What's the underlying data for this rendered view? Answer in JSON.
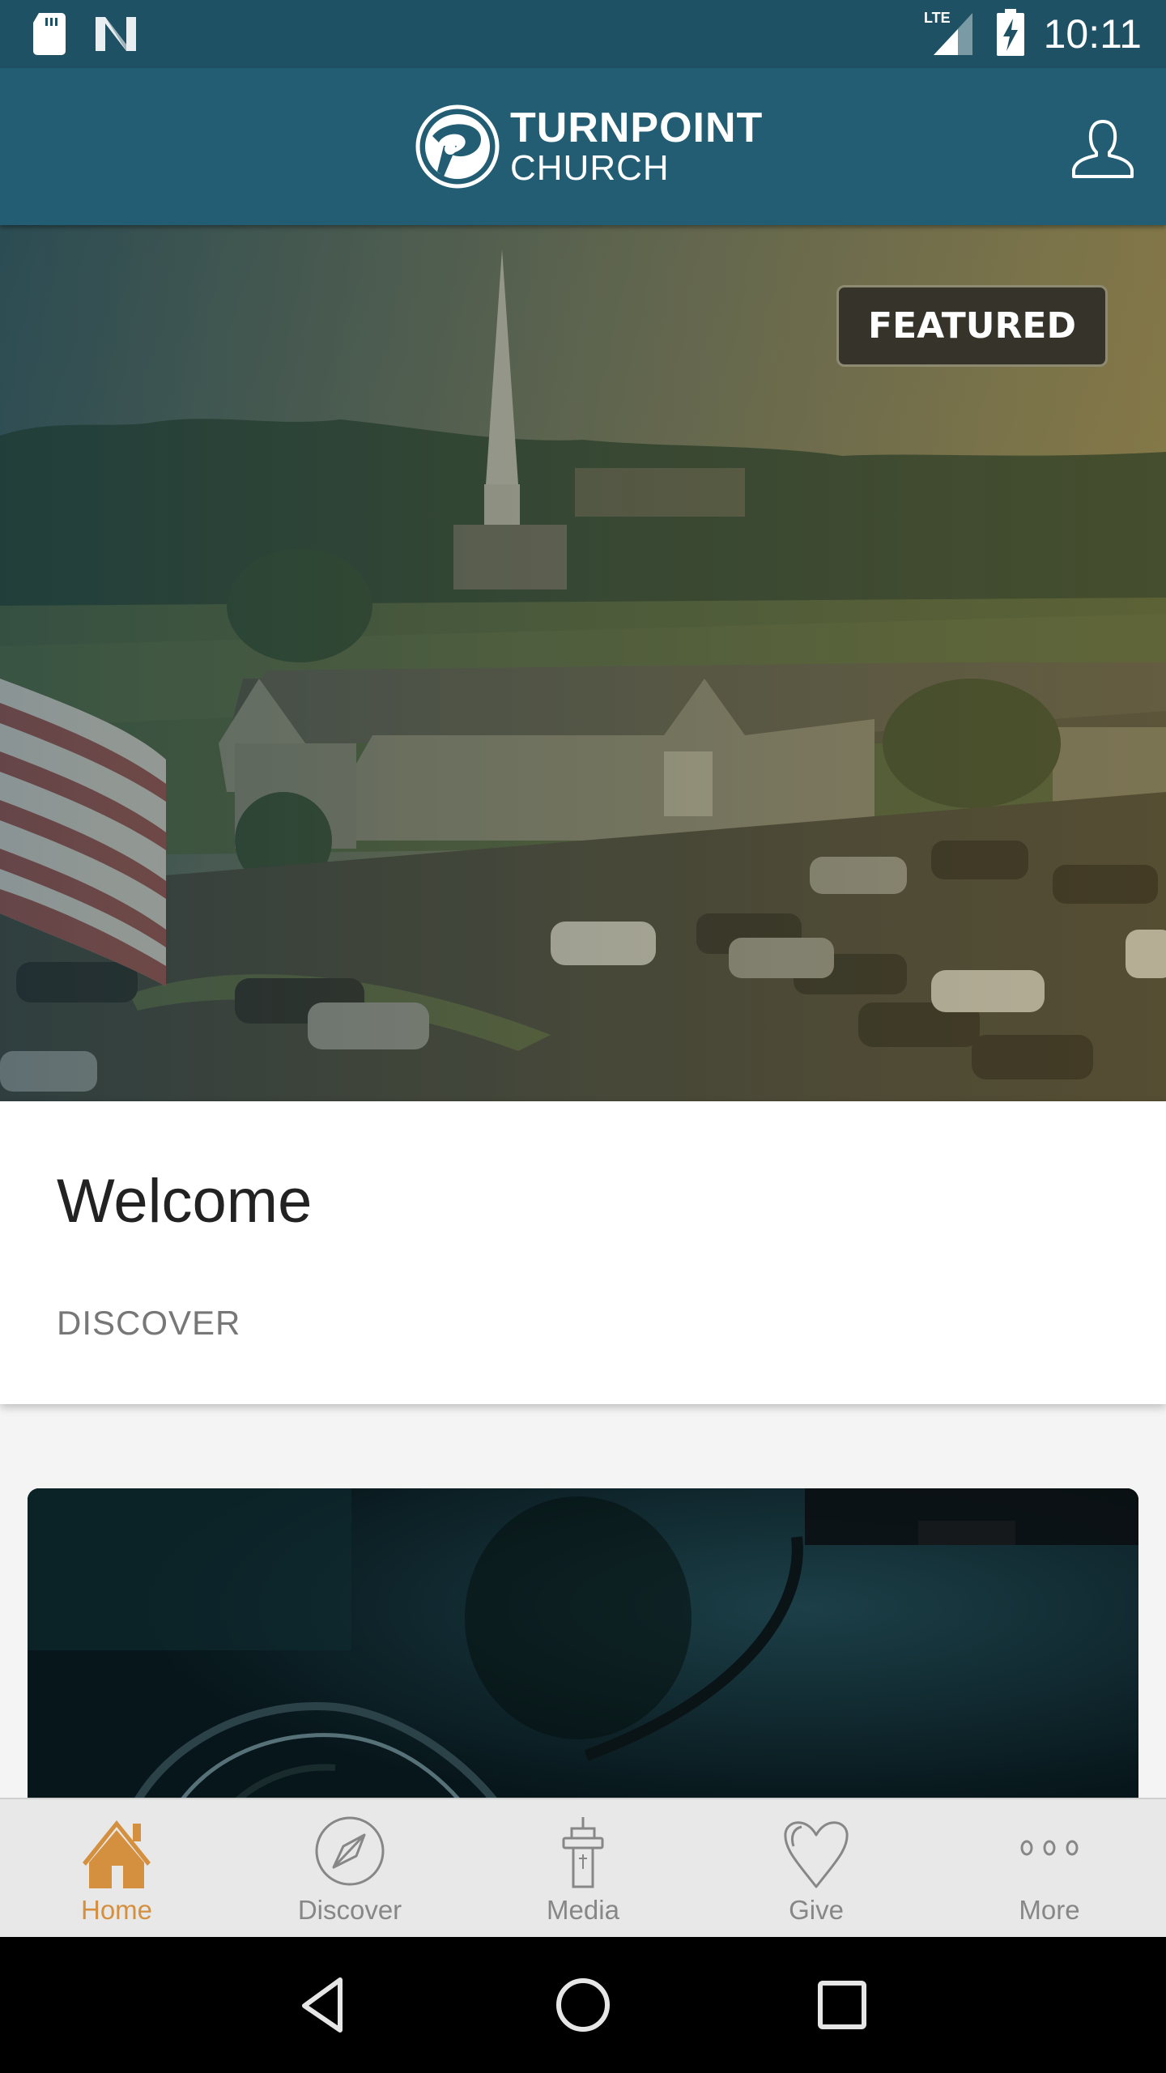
{
  "status_bar": {
    "time": "10:11",
    "network": "LTE",
    "icons": [
      "sd-card-icon",
      "n-notification-icon",
      "lte-signal-icon",
      "battery-charging-icon"
    ]
  },
  "app_bar": {
    "brand_line1": "TURNPOINT",
    "brand_line2": "CHURCH",
    "profile_icon": "user-profile-icon",
    "background_color": "#225d73"
  },
  "hero": {
    "badge": "FEATURED",
    "image_description": "Aerial view of church building with steeple, parking lot and flag"
  },
  "welcome_card": {
    "title": "Welcome",
    "subtitle": "DISCOVER"
  },
  "media_card": {
    "image_description": "Dark teal close-up photo of microphone"
  },
  "tab_bar": {
    "active_color": "#d4903f",
    "inactive_color": "#878787",
    "tabs": [
      {
        "label": "Home",
        "icon": "home-icon",
        "active": true
      },
      {
        "label": "Discover",
        "icon": "compass-icon",
        "active": false
      },
      {
        "label": "Media",
        "icon": "pulpit-icon",
        "active": false
      },
      {
        "label": "Give",
        "icon": "heart-icon",
        "active": false
      },
      {
        "label": "More",
        "icon": "more-dots-icon",
        "active": false
      }
    ]
  },
  "nav_bar": {
    "buttons": [
      "back-icon",
      "home-circle-icon",
      "recents-icon"
    ]
  }
}
